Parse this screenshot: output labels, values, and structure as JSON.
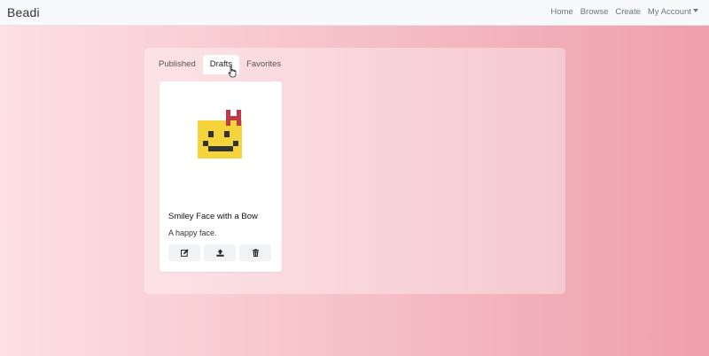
{
  "navbar": {
    "brand": "Beadi",
    "links": [
      "Home",
      "Browse",
      "Create",
      "My Account"
    ]
  },
  "tabs": [
    {
      "label": "Published",
      "active": false
    },
    {
      "label": "Drafts",
      "active": true
    },
    {
      "label": "Favorites",
      "active": false
    }
  ],
  "card": {
    "title": "Smiley Face with a Bow",
    "description": "A happy face.",
    "actions": [
      "edit-icon",
      "upload-icon",
      "trash-icon"
    ]
  },
  "colors": {
    "face": "#f5d33a",
    "face_features": "#333333",
    "bow": "#c0394b"
  }
}
